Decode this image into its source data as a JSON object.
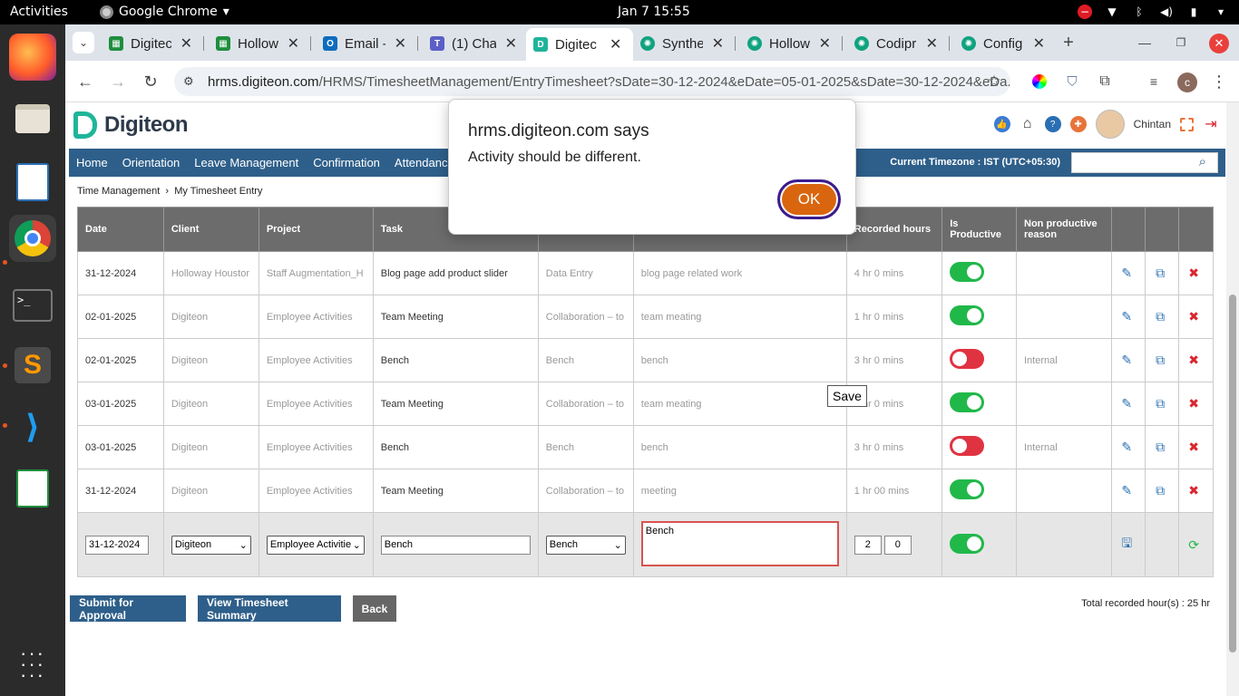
{
  "system": {
    "activities": "Activities",
    "app_name": "Google Chrome",
    "clock": "Jan 7  15:55"
  },
  "tabs": [
    {
      "title": "Digitec",
      "icon": "sheets-icon",
      "color": "#1e8e3e"
    },
    {
      "title": "Hollow",
      "icon": "sheets-icon",
      "color": "#1e8e3e"
    },
    {
      "title": "Email -",
      "icon": "outlook-icon",
      "color": "#0f6cbd"
    },
    {
      "title": "(1) Cha",
      "icon": "teams-icon",
      "color": "#5b5fc7"
    },
    {
      "title": "Digitec",
      "icon": "digiteon-icon",
      "color": "#1fb59a"
    },
    {
      "title": "Synthe",
      "icon": "chatgpt-icon",
      "color": "#10a37f"
    },
    {
      "title": "Hollow",
      "icon": "chatgpt-icon",
      "color": "#10a37f"
    },
    {
      "title": "Codipr",
      "icon": "chatgpt-icon",
      "color": "#10a37f"
    },
    {
      "title": "Config",
      "icon": "chatgpt-icon",
      "color": "#10a37f"
    }
  ],
  "address": {
    "host": "hrms.digiteon.com",
    "path": "/HRMS/TimesheetManagement/EntryTimesheet?sDate=30-12-2024&eDate=05-01-2025&sDate=30-12-2024&eDa..."
  },
  "site": {
    "brand": "Digiteon",
    "username": "Chintan",
    "menu": [
      "Home",
      "Orientation",
      "Leave Management",
      "Confirmation",
      "Attendance Trac"
    ],
    "timezone": "Current Timezone : IST (UTC+05:30)",
    "breadcrumb": [
      "Time Management",
      "My Timesheet Entry"
    ]
  },
  "table": {
    "headers": {
      "date": "Date",
      "client": "Client",
      "project": "Project",
      "task": "Task",
      "recorded": "Recorded hours",
      "productive": "Is Productive",
      "reason": "Non productive reason"
    },
    "rows": [
      {
        "date": "31-12-2024",
        "client": "Holloway Houstor",
        "project": "Staff Augmentation_H",
        "task": "Blog page add product slider",
        "activity": "Data Entry",
        "description": "blog page related work",
        "hours": "4 hr 0 mins",
        "productive": true,
        "reason": ""
      },
      {
        "date": "02-01-2025",
        "client": "Digiteon",
        "project": "Employee Activities",
        "task": "Team Meeting",
        "activity": "Collaboration – to",
        "description": "team meating",
        "hours": "1 hr 0 mins",
        "productive": true,
        "reason": ""
      },
      {
        "date": "02-01-2025",
        "client": "Digiteon",
        "project": "Employee Activities",
        "task": "Bench",
        "activity": "Bench",
        "description": "bench",
        "hours": "3 hr 0 mins",
        "productive": false,
        "reason": "Internal"
      },
      {
        "date": "03-01-2025",
        "client": "Digiteon",
        "project": "Employee Activities",
        "task": "Team Meeting",
        "activity": "Collaboration – to",
        "description": "team meating",
        "hours": "1 hr 0 mins",
        "productive": true,
        "reason": ""
      },
      {
        "date": "03-01-2025",
        "client": "Digiteon",
        "project": "Employee Activities",
        "task": "Bench",
        "activity": "Bench",
        "description": "bench",
        "hours": "3 hr 0 mins",
        "productive": false,
        "reason": "Internal"
      },
      {
        "date": "31-12-2024",
        "client": "Digiteon",
        "project": "Employee Activities",
        "task": "Team Meeting",
        "activity": "Collaboration – to",
        "description": "meeting",
        "hours": "1 hr 00 mins",
        "productive": true,
        "reason": ""
      }
    ],
    "edit_row": {
      "date": "31-12-2024",
      "client": "Digiteon",
      "project": "Employee Activitie",
      "task": "Bench",
      "activity": "Bench",
      "description": "Bench",
      "hours": "2",
      "minutes": "0"
    }
  },
  "tooltip": "Save",
  "buttons": {
    "submit": "Submit for Approval",
    "summary": "View Timesheet Summary",
    "back": "Back"
  },
  "total": "Total recorded hour(s) : 25 hr",
  "dialog": {
    "title": "hrms.digiteon.com says",
    "message": "Activity should be different.",
    "ok": "OK"
  },
  "colors": {
    "nav": "#2e5f8a",
    "toggle_on": "#21b84a",
    "toggle_off": "#e03341",
    "ok_button": "#d9650e"
  }
}
